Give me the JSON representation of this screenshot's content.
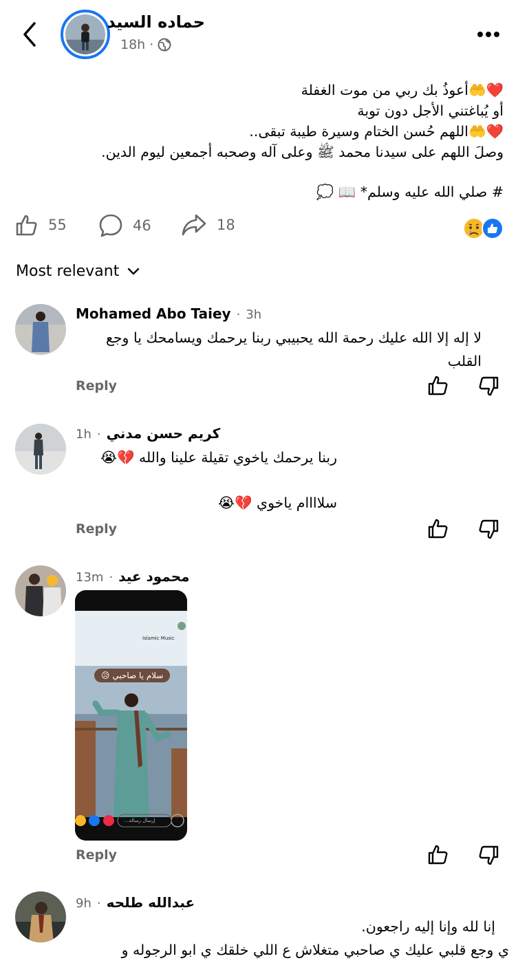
{
  "post": {
    "author": "حماده السيد",
    "time": "18h",
    "lines": [
      "❤️🤲أعوذُ بك ربي من موت الغفلة",
      "أو يُباغتني الأجل دون توبة",
      "❤️🤲اللهم حُسن الختام وسيرة طيبة تبقى..",
      "وصلَ اللهم على سيدنا محمد ﷺ وعلى آله وصحبه أجمعين ليوم الدين."
    ],
    "hashtag": "# صلي الله عليه وسلم* 📖 💭",
    "likes": "55",
    "comments": "46",
    "shares": "18"
  },
  "sort_label": "Most relevant",
  "reply_label": "Reply",
  "comments": [
    {
      "name": "Mohamed Abo Taiey",
      "time": "3h",
      "text": "لا إله إلا الله عليك رحمة الله يحبيبي ربنا يرحمك ويسامحك يا وجع القلب"
    },
    {
      "name": "كريم  حسن مدني",
      "time": "1h",
      "text": "ربنا يرحمك ياخوي تقيلة علينا والله 💔😭",
      "text2": "سلاااام ياخوي 💔😭"
    },
    {
      "name": "محمود  عيد",
      "time": "13m",
      "image": {
        "music_label": "Islamic Music",
        "caption": "سلام يا صاحبي 😥",
        "input_placeholder": "إرسال رسالة..."
      }
    },
    {
      "name": "عبدالله  طلحه",
      "time": "9h",
      "text": "إنا لله وإنا إليه راجعون.",
      "text2": "ي وجع قلبي عليك ي صاحبي متغلاش ع اللي خلقك ي ابو الرجوله و"
    }
  ],
  "colors": {
    "accent": "#1877f2",
    "secondary_text": "#65676b"
  }
}
